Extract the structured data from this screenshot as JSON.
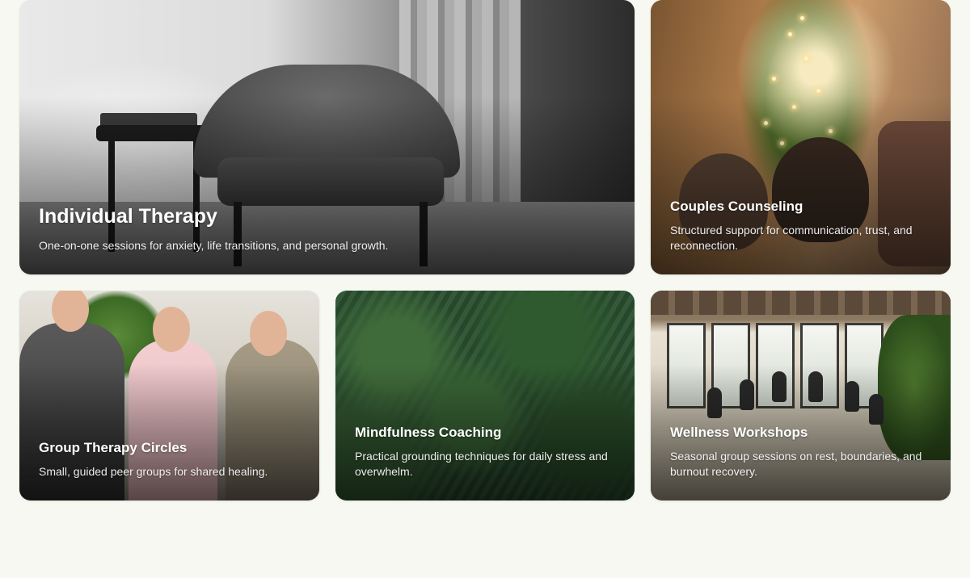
{
  "cards": [
    {
      "title": "Individual Therapy",
      "description": "One-on-one sessions for anxiety, life transitions, and personal growth."
    },
    {
      "title": "Couples Counseling",
      "description": "Structured support for communication, trust, and reconnection."
    },
    {
      "title": "Group Therapy Circles",
      "description": "Small, guided peer groups for shared healing."
    },
    {
      "title": "Mindfulness Coaching",
      "description": "Practical grounding techniques for daily stress and overwhelm."
    },
    {
      "title": "Wellness Workshops",
      "description": "Seasonal group sessions on rest, boundaries, and burnout recovery."
    }
  ],
  "colors": {
    "page_background": "#f7f8f2",
    "card_text": "#ffffff"
  }
}
